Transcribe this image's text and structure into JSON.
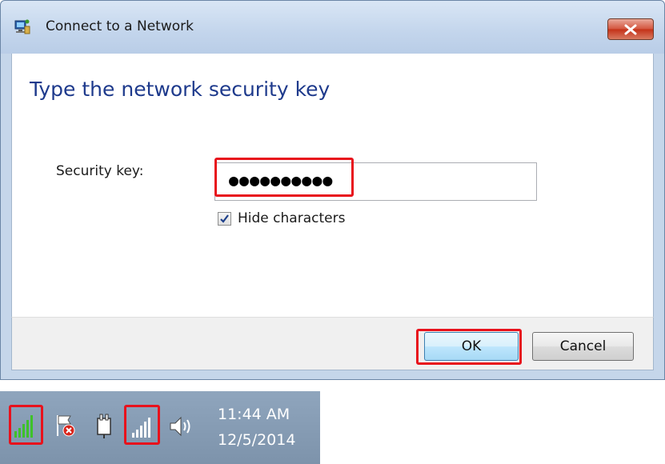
{
  "window": {
    "title": "Connect to a Network",
    "close_glyph": "✕"
  },
  "main": {
    "heading": "Type the network security key",
    "security_key_label": "Security key:",
    "security_key_value": "●●●●●●●●●●",
    "hide_characters_label": "Hide characters",
    "hide_characters_checked": true
  },
  "footer": {
    "ok_label": "OK",
    "cancel_label": "Cancel"
  },
  "tray": {
    "icons": [
      "wifi-signal-green-icon",
      "action-center-flag-error-icon",
      "power-plug-icon",
      "wifi-signal-icon",
      "speaker-volume-icon"
    ],
    "time": "11:44 AM",
    "date": "12/5/2014"
  },
  "colors": {
    "highlight": "#e8121c",
    "heading": "#1e3a8c",
    "signal_green": "#3ec12a"
  }
}
